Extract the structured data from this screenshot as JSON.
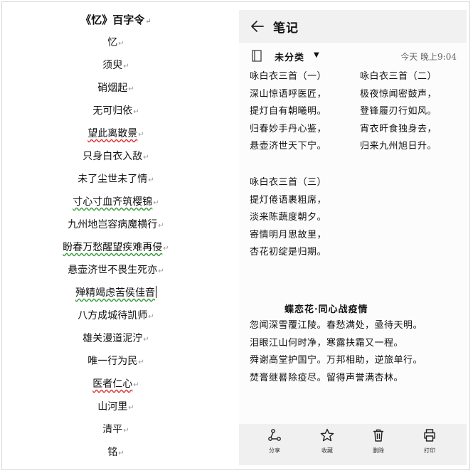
{
  "document": {
    "title": "《忆》百字令",
    "lines": [
      "忆",
      "须臾",
      "硝烟起",
      "无可归依",
      "望此离散景",
      "只身白衣入敌",
      "未了尘世未了情",
      "寸心寸血齐筑樱锦",
      "九州地岂容病魔横行",
      "盼春万愁醒望疾难再侵",
      "悬壶济世不畏生死亦",
      "殚精竭虑苦侯佳音",
      "八方成城待凯师",
      "雄关漫道泥泞",
      "唯一行为民",
      "医者仁心",
      "山河里",
      "清平",
      "铭"
    ],
    "paragraph_mark": "↵"
  },
  "notes_app": {
    "header_title": "笔记",
    "category": "未分类",
    "timestamp": "今天 晚上9:04",
    "poem1": {
      "title": "咏白衣三首（一）",
      "lines": [
        "深山惊语呼医匠，",
        "提灯自有朝曦明。",
        "归春妙手丹心鉴，",
        "悬壶济世天下宁。"
      ]
    },
    "poem2": {
      "title": "咏白衣三首（二）",
      "lines": [
        "极夜惊闻密鼓声，",
        "登锋履刃行如风。",
        "宵衣旰食独身去，",
        "归来九州旭日升。"
      ]
    },
    "poem3": {
      "title": "咏白衣三首（三）",
      "lines": [
        "提灯倦语裹粗席，",
        "淡来陈蔬度朝夕。",
        "寄情明月思故里，",
        "杏花初绽是归期。"
      ]
    },
    "poem4": {
      "title": "蝶恋花·同心战疫情",
      "lines": [
        "忽闻深雪覆江陵。春愁满处，亟待天明。",
        "泪眼江山何时净，寒露扶霜又一程。",
        "舜谢高堂护国宁。万邦相助，逆旅单行。",
        "焚膏继晷除疫尽。留得声誉满杏林。"
      ]
    },
    "bottom_actions": [
      {
        "label": "分享",
        "icon": "share-icon"
      },
      {
        "label": "收藏",
        "icon": "star-icon"
      },
      {
        "label": "删除",
        "icon": "trash-icon"
      },
      {
        "label": "打印",
        "icon": "print-icon"
      }
    ]
  }
}
